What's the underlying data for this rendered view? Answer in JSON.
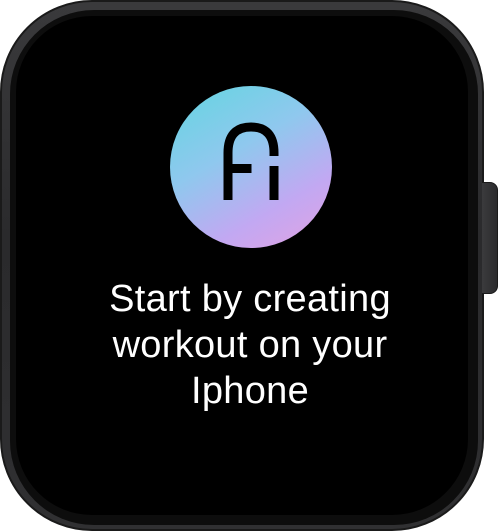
{
  "app": {
    "logo_icon": "fi-letter-logo-icon",
    "logo_colors": [
      "#62d6e0",
      "#8fc8ee",
      "#c2a8f2",
      "#e3a2e2"
    ]
  },
  "message": {
    "lines": [
      "Start by creating",
      "workout on your",
      "Iphone"
    ]
  },
  "device": {
    "case_color": "#333335",
    "screen_color": "#000000"
  }
}
